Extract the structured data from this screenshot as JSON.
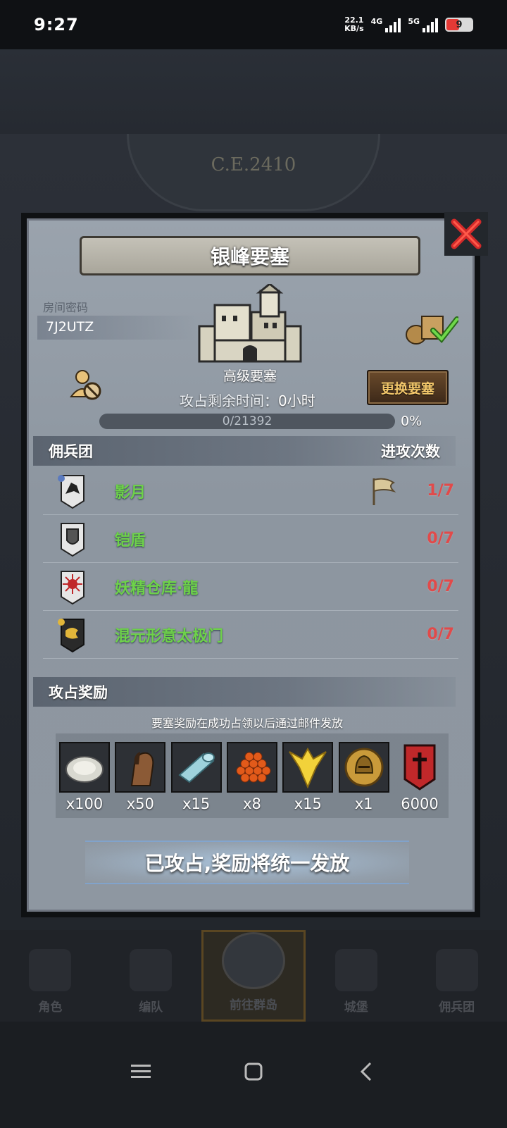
{
  "status_bar": {
    "time": "9:27",
    "net_speed_value": "22.1",
    "net_speed_unit": "KB/s",
    "sim1_label": "4G",
    "sim2_label": "5G",
    "battery": "9"
  },
  "background": {
    "era": "C.E.2410"
  },
  "modal": {
    "title": "银峰要塞",
    "room_label": "房间密码",
    "room_code": "7J2UTZ",
    "fortress_name": "高级要塞",
    "change_button": "更换要塞",
    "remain_label": "攻占剩余时间：",
    "remain_value": "0小时",
    "progress_text": "0/21392",
    "progress_fraction": 0,
    "progress_percent": "0%",
    "mercenary_header": "佣兵团",
    "attack_header": "进攻次数",
    "mercenaries": [
      {
        "name": "影月",
        "count": "1/7",
        "icon": "wolf-banner-icon"
      },
      {
        "name": "铠盾",
        "count": "0/7",
        "icon": "shield-banner-icon"
      },
      {
        "name": "妖精仓库·龍",
        "count": "0/7",
        "icon": "sun-banner-icon"
      },
      {
        "name": "混元形意太极门",
        "count": "0/7",
        "icon": "dragon-banner-icon"
      }
    ],
    "reward_header": "攻占奖励",
    "reward_note": "要塞奖励在成功占领以后通过邮件发放",
    "rewards": [
      {
        "icon": "oyster-icon",
        "qty": "x100"
      },
      {
        "icon": "horse-icon",
        "qty": "x50"
      },
      {
        "icon": "cloth-roll-icon",
        "qty": "x15"
      },
      {
        "icon": "roe-icon",
        "qty": "x8"
      },
      {
        "icon": "gold-crest-icon",
        "qty": "x15"
      },
      {
        "icon": "helmet-medal-icon",
        "qty": "x1"
      },
      {
        "icon": "mercenary-banner-icon",
        "qty": "6000"
      }
    ],
    "claim_text": "已攻占,奖励将统一发放"
  },
  "bottom_nav": [
    {
      "label": "角色"
    },
    {
      "label": "编队"
    },
    {
      "label": "前往群岛"
    },
    {
      "label": "城堡"
    },
    {
      "label": "佣兵团"
    }
  ]
}
